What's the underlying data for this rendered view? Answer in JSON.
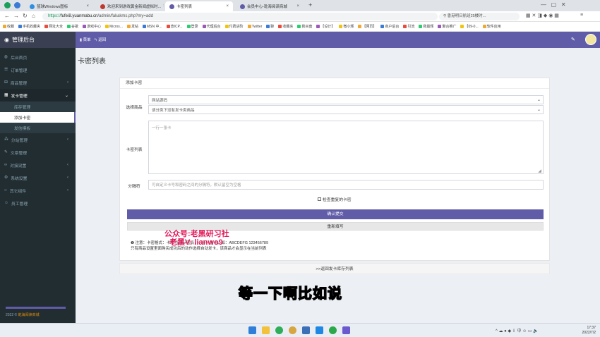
{
  "browser": {
    "tabs": [
      {
        "label": "篮球Windows图标",
        "active": false
      },
      {
        "label": "欢迎来到游戏黄金新闻虚拟时...",
        "active": false
      },
      {
        "label": "卡密列表",
        "active": true
      },
      {
        "label": "会员中心-乾海阅读商城",
        "active": false
      }
    ],
    "url_prefix": "https://",
    "url_host": "fufei8.yuanmabu.cn",
    "url_path": "/admin/fakakms.php?my=add",
    "search_placeholder": "香港明日航班25楼时...",
    "bookmarks": [
      "收藏",
      "手机收藏夹",
      "网址大全",
      "谷歌",
      "游戏中心",
      "Micros...",
      "发帖",
      "MSN 中...",
      "查ICP...",
      "登录",
      "代理后台",
      "付费进阶",
      "Twitter",
      "聊",
      "收藏夹",
      "我买盘",
      "【设计】",
      "微小辉",
      "【网页】",
      "商户后台",
      "引流",
      "我最辉",
      "聚合推广",
      "【09-0...",
      "软件应用"
    ]
  },
  "app": {
    "brand": "管理后台",
    "topbar_menu": "菜单",
    "topbar_back": "返回"
  },
  "sidebar": {
    "items": [
      {
        "label": "后台首页",
        "icon": "home-icon"
      },
      {
        "label": "订单管理",
        "icon": "list-icon"
      },
      {
        "label": "商品管理",
        "icon": "cart-icon",
        "arrow": "‹"
      },
      {
        "label": "发卡管理",
        "icon": "grid-icon",
        "arrow": "⌄",
        "active": true
      },
      {
        "label": "分站管理",
        "icon": "sitemap-icon",
        "arrow": "‹"
      },
      {
        "label": "文章管理",
        "icon": "pencil-icon"
      },
      {
        "label": "对接设置",
        "icon": "link-icon",
        "arrow": "‹"
      },
      {
        "label": "系统设置",
        "icon": "gear-icon",
        "arrow": "‹"
      },
      {
        "label": "其它组件",
        "icon": "code-icon",
        "arrow": "‹"
      },
      {
        "label": "员工管理",
        "icon": "user-icon"
      }
    ],
    "subitems": [
      {
        "label": "库存管理"
      },
      {
        "label": "添加卡密",
        "current": true
      },
      {
        "label": "发信模板"
      }
    ],
    "footer_year": "2022 ©",
    "footer_name": "乾海阅读商城"
  },
  "main": {
    "page_title": "卡密列表",
    "panel_title": "添加卡密",
    "select_label": "选择商品",
    "category_value": "网站源码",
    "product_value": "该分类下没有发卡类商品",
    "cards_label": "卡密列表",
    "cards_placeholder": "一行一张卡",
    "separator_label": "分隔符",
    "separator_placeholder": "可自定义卡号和密码之间的分隔符，默认留空为空格",
    "check_duplicate": "检查重复的卡密",
    "submit_label": "确认提交",
    "reset_label": "重新填写",
    "note_line1": "注意：卡密格式：卡号+空格+密码，一行一张卡，如：ABCDEFG 123456789",
    "note_line2": "只有商品设置里面购买成功后的动作选择自动发卡，该商品才会显示在当前列表",
    "back_link": ">>返回发卡库存列表"
  },
  "overlay": {
    "watermark1": "公众号:老黑研习社",
    "watermark2": "老黑V: lianwo9",
    "subtitle": "等一下啊比如说"
  },
  "taskbar": {
    "time": "17:37",
    "date": "2022/7/2",
    "ime": "中"
  }
}
